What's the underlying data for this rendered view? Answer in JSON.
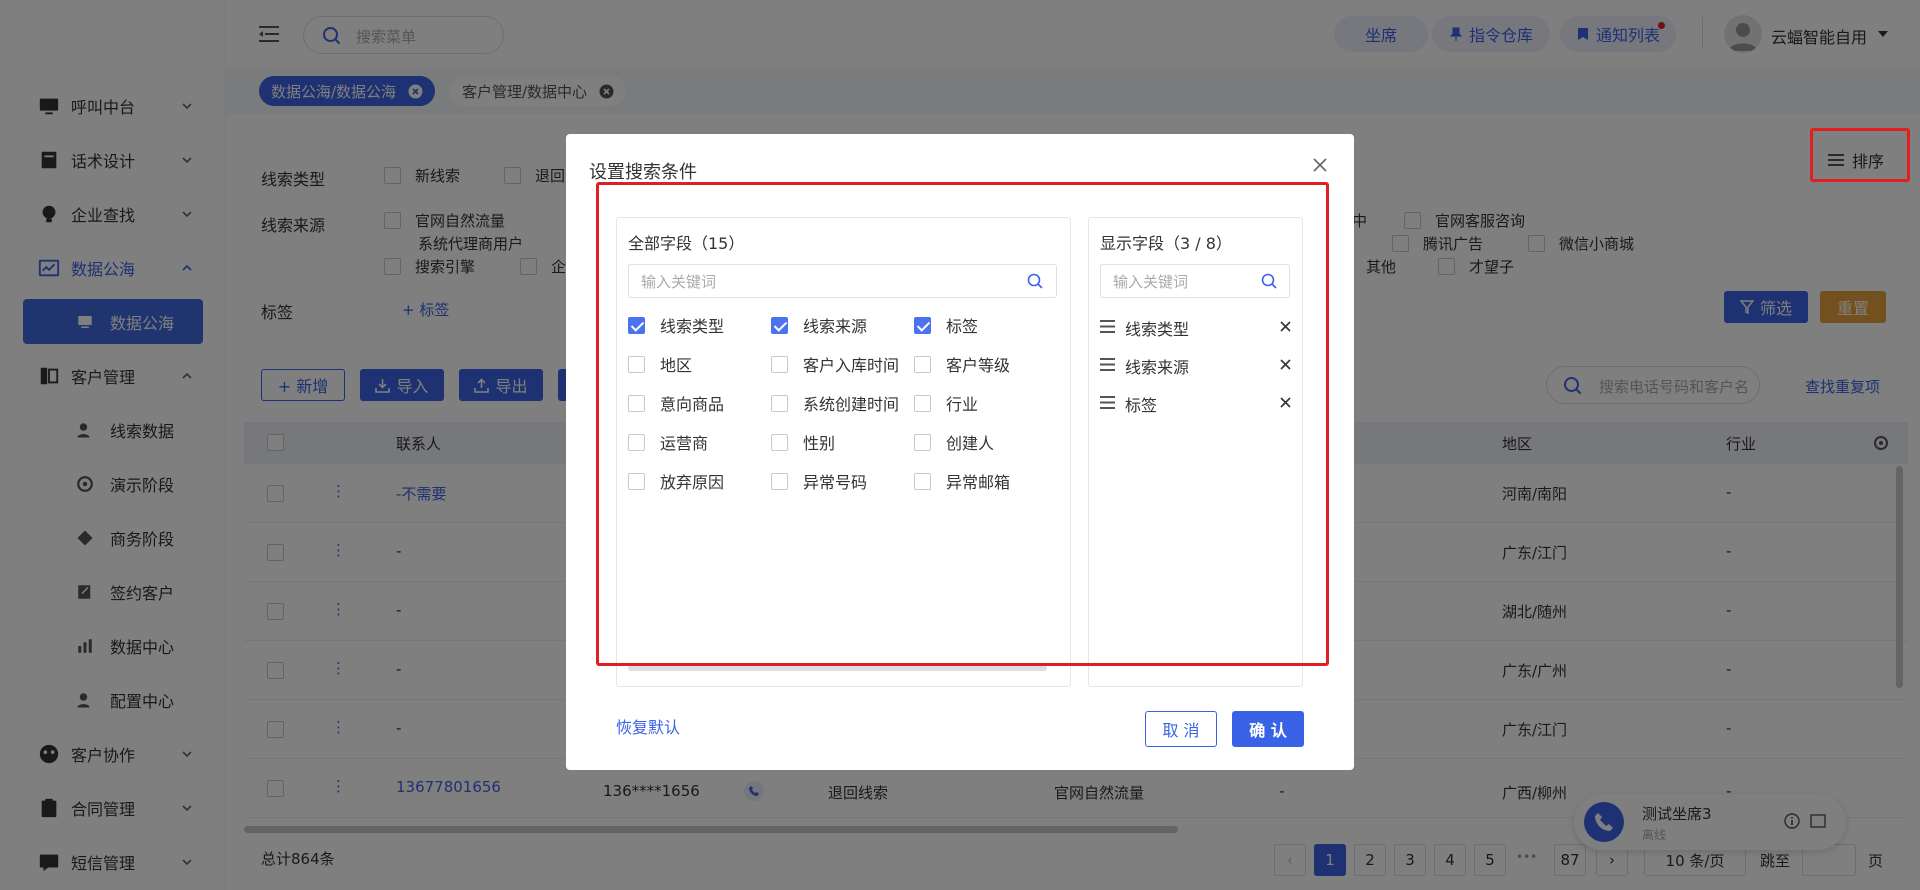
{
  "header": {
    "search_placeholder": "搜索菜单",
    "btn_seat": "坐席",
    "btn_command": "指令仓库",
    "btn_notify": "通知列表",
    "user_name": "云蝠智能自用"
  },
  "tabs": [
    {
      "label": "数据公海/数据公海",
      "active": true
    },
    {
      "label": "客户管理/数据中心",
      "active": false
    }
  ],
  "sidebar": {
    "items": [
      {
        "label": "呼叫中台",
        "icon": "monitor-icon"
      },
      {
        "label": "话术设计",
        "icon": "book-icon"
      },
      {
        "label": "企业查找",
        "icon": "bulb-icon"
      },
      {
        "label": "数据公海",
        "icon": "chart-icon"
      },
      {
        "label": "数据公海",
        "icon": "computer-icon"
      },
      {
        "label": "客户管理",
        "icon": "contacts-icon"
      },
      {
        "label": "线索数据",
        "icon": "user-icon"
      },
      {
        "label": "演示阶段",
        "icon": "target-icon"
      },
      {
        "label": "商务阶段",
        "icon": "diamond-icon"
      },
      {
        "label": "签约客户",
        "icon": "edit-icon"
      },
      {
        "label": "数据中心",
        "icon": "bar-chart-icon"
      },
      {
        "label": "配置中心",
        "icon": "user-settings-icon"
      },
      {
        "label": "客户协作",
        "icon": "team-icon"
      },
      {
        "label": "合同管理",
        "icon": "clipboard-icon"
      },
      {
        "label": "短信管理",
        "icon": "message-icon"
      }
    ]
  },
  "filter": {
    "lead_type_label": "线索类型",
    "lead_type_opts": [
      "新线索",
      "退回"
    ],
    "lead_source_label": "线索来源",
    "source_row1": [
      "官网自然流量",
      "官网客服咨询"
    ],
    "source_row2": [
      "系统代理商用户",
      "腾讯广告",
      "微信小商城"
    ],
    "source_row3": [
      "搜索引擎",
      "企",
      "其他",
      "才望子"
    ],
    "source_row1_partial": "中",
    "tag_label": "标签",
    "add_tag": "+ 标签",
    "sort_label": "排序",
    "filter_btn": "筛选",
    "reset_btn": "重置"
  },
  "toolbar": {
    "add": "+ 新增",
    "import": "导入",
    "export": "导出",
    "search_placeholder": "搜索电话号码和客户名",
    "find_dup": "查找重复项"
  },
  "table": {
    "headers": {
      "contact": "联系人",
      "region": "地区",
      "industry": "行业"
    },
    "rows": [
      {
        "contact": "-不需要",
        "region": "河南/南阳",
        "industry": "-"
      },
      {
        "contact": "-",
        "region": "广东/江门",
        "industry": "-"
      },
      {
        "contact": "-",
        "region": "湖北/随州",
        "industry": "-"
      },
      {
        "contact": "-",
        "region": "广东/广州",
        "industry": "-"
      },
      {
        "contact": "-",
        "region": "广东/江门",
        "industry": "-"
      },
      {
        "contact": "13677801656",
        "phone": "136****1656",
        "type": "退回线索",
        "source": "官网自然流量",
        "extra": "-",
        "region": "广西/柳州",
        "industry": "-"
      }
    ]
  },
  "footer": {
    "total": "总计864条",
    "pages": [
      "1",
      "2",
      "3",
      "4",
      "5",
      "87"
    ],
    "ellipsis": "•••",
    "per_page": "10 条/页",
    "jump": "跳至",
    "page_unit": "页"
  },
  "softphone": {
    "name": "测试坐席3",
    "status": "离线"
  },
  "modal": {
    "title": "设置搜索条件",
    "all_fields_title": "全部字段（15）",
    "shown_fields_title": "显示字段（3 / 8）",
    "search_placeholder": "输入关键词",
    "fields": [
      {
        "label": "线索类型",
        "checked": true
      },
      {
        "label": "线索来源",
        "checked": true
      },
      {
        "label": "标签",
        "checked": true
      },
      {
        "label": "地区",
        "checked": false
      },
      {
        "label": "客户入库时间",
        "checked": false
      },
      {
        "label": "客户等级",
        "checked": false
      },
      {
        "label": "意向商品",
        "checked": false
      },
      {
        "label": "系统创建时间",
        "checked": false
      },
      {
        "label": "行业",
        "checked": false
      },
      {
        "label": "运营商",
        "checked": false
      },
      {
        "label": "性别",
        "checked": false
      },
      {
        "label": "创建人",
        "checked": false
      },
      {
        "label": "放弃原因",
        "checked": false
      },
      {
        "label": "异常号码",
        "checked": false
      },
      {
        "label": "异常邮箱",
        "checked": false
      }
    ],
    "selected": [
      "线索类型",
      "线索来源",
      "标签"
    ],
    "restore": "恢复默认",
    "cancel": "取 消",
    "confirm": "确 认"
  },
  "colors": {
    "primary": "#3a62e6",
    "highlight": "#e02020",
    "warning": "#e6a23c"
  }
}
